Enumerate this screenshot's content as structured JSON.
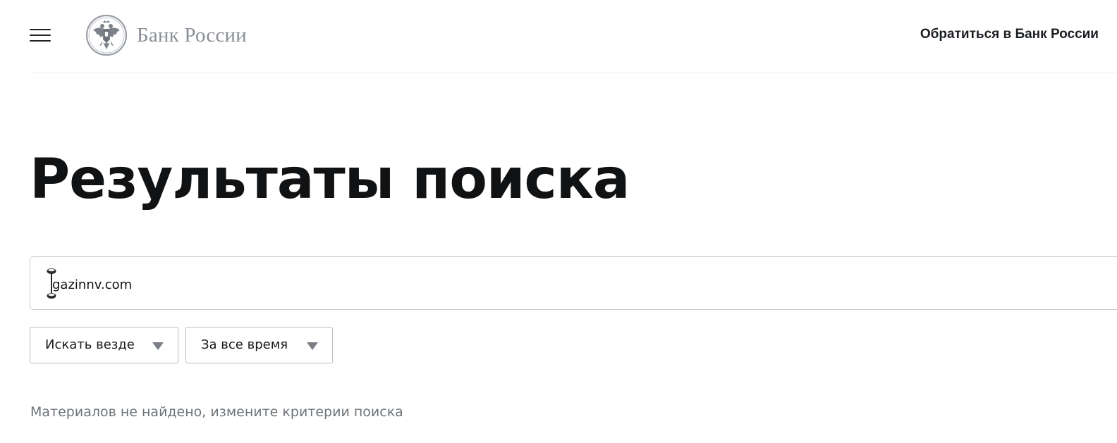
{
  "header": {
    "logo_text": "Банк России",
    "contact_link": "Обратиться в Банк России"
  },
  "page_title": "Результаты поиска",
  "search": {
    "value": "gazinnv.com"
  },
  "filters": {
    "where": {
      "selected": "Искать везде"
    },
    "when": {
      "selected": "За все время"
    }
  },
  "results": {
    "empty_message": "Материалов не найдено, измените критерии поиска"
  },
  "colors": {
    "logo_gray": "#8a8f96",
    "title": "#111214",
    "muted_text": "#6e7378",
    "border": "#c9ccd0"
  }
}
